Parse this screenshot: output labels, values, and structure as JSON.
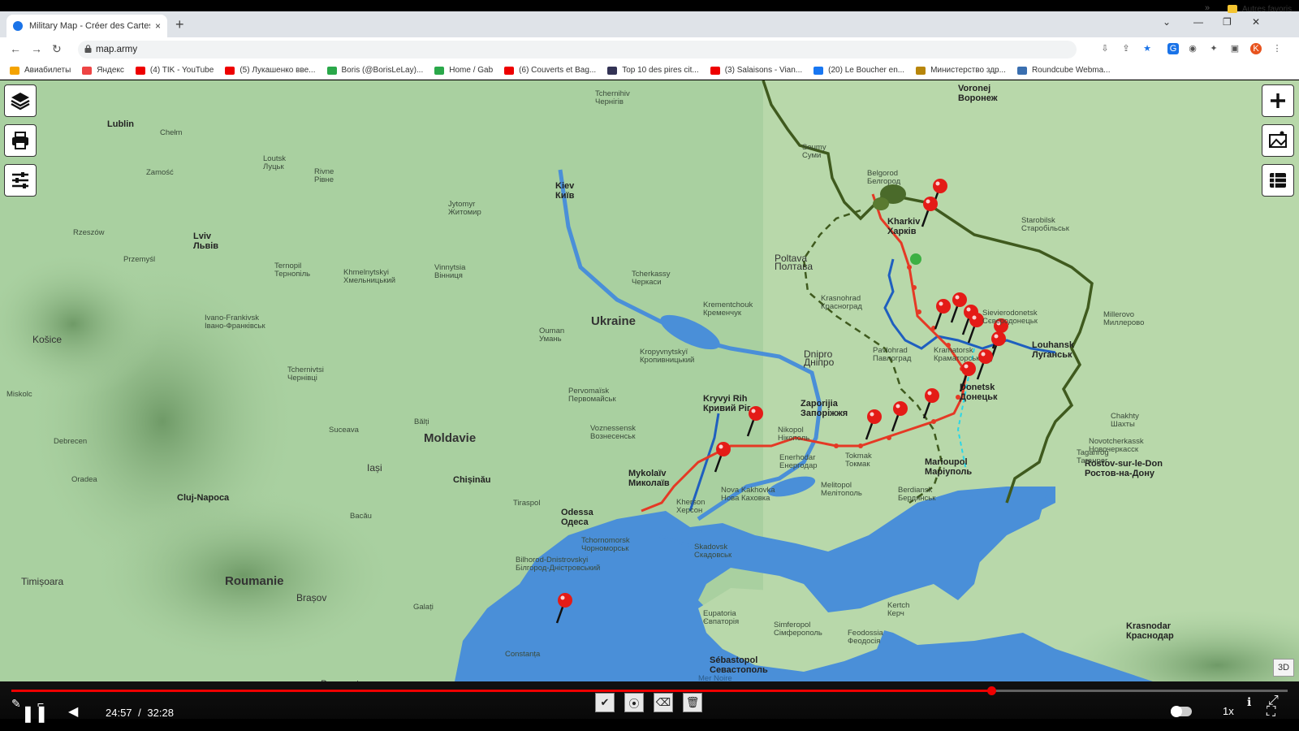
{
  "browser": {
    "tab_title": "Military Map - Créer des Cartes M",
    "tab_close": "×",
    "new_tab": "+",
    "url": "map.army",
    "bookmarks": [
      {
        "label": "Авиабилеты",
        "color": "#f4a300"
      },
      {
        "label": "Яндекс",
        "color": "#e44"
      },
      {
        "label": "(4) TIK - YouTube",
        "color": "#e00"
      },
      {
        "label": "(5) Лукашенко вве...",
        "color": "#e00"
      },
      {
        "label": "Boris (@BorisLeLay)...",
        "color": "#2aa84a"
      },
      {
        "label": "Home / Gab",
        "color": "#2aa84a"
      },
      {
        "label": "(6) Couverts et Bag...",
        "color": "#e00"
      },
      {
        "label": "Top 10 des pires cit...",
        "color": "#335"
      },
      {
        "label": "(3) Salaisons - Vian...",
        "color": "#e00"
      },
      {
        "label": "(20) Le Boucher en...",
        "color": "#1877f2"
      },
      {
        "label": "Министерство здр...",
        "color": "#b8860b"
      },
      {
        "label": "Roundcube Webma...",
        "color": "#3a6fb0"
      }
    ],
    "bookmarks_more": "»",
    "other_bookmarks": "Autres favoris",
    "profile_initial": "K"
  },
  "map": {
    "labels": [
      {
        "t": "Ukraine",
        "c": "big"
      },
      {
        "t": "Moldavie",
        "c": "big"
      },
      {
        "t": "Roumanie",
        "c": "big"
      },
      {
        "t": "Kiev|Київ",
        "c": "city"
      },
      {
        "t": "Poltava|Полтава",
        "c": "mid"
      },
      {
        "t": "Dnipro|Дніпро",
        "c": "mid"
      },
      {
        "t": "Zaporijia|Запоріжжя",
        "c": "city"
      },
      {
        "t": "Kryvyi Rih|Кривий Ріг",
        "c": "city"
      },
      {
        "t": "Mykolaïv|Миколаїв",
        "c": "city"
      },
      {
        "t": "Odessa|Одеса",
        "c": "city"
      },
      {
        "t": "Chișinău",
        "c": "city"
      },
      {
        "t": "Lviv|Львів",
        "c": "city"
      },
      {
        "t": "Kharkiv|Харків",
        "c": "city"
      },
      {
        "t": "Marioupol|Маріуполь",
        "c": "city"
      },
      {
        "t": "Rostov-sur-le-Don|Ростов-на-Дону",
        "c": "city"
      },
      {
        "t": "Lublin",
        "c": "city"
      },
      {
        "t": "Cluj-Napoca",
        "c": "city"
      },
      {
        "t": "Sébastopol|Севастополь",
        "c": "city"
      },
      {
        "t": "Krasnodar|Краснодар",
        "c": "city"
      },
      {
        "t": "Voronej|Воронеж",
        "c": "city"
      },
      {
        "t": "Louhansk|Луганськ",
        "c": "city"
      },
      {
        "t": "Donetsk|Донецьк",
        "c": "city"
      },
      {
        "t": "Belgorod|Белгород",
        "c": ""
      },
      {
        "t": "Soumy|Суми",
        "c": ""
      },
      {
        "t": "Tchernihiv|Чернігів",
        "c": ""
      },
      {
        "t": "Jytomyr|Житомир",
        "c": ""
      },
      {
        "t": "Vinnytsia|Вінниця",
        "c": ""
      },
      {
        "t": "Tcherkassy|Черкаси",
        "c": ""
      },
      {
        "t": "Krementchouk|Кременчук",
        "c": ""
      },
      {
        "t": "Kropyvnytskyï|Кропивницький",
        "c": ""
      },
      {
        "t": "Ouman|Умань",
        "c": ""
      },
      {
        "t": "Khmelnytskyi|Хмельницький",
        "c": ""
      },
      {
        "t": "Ternopil|Тернопіль",
        "c": ""
      },
      {
        "t": "Rivne|Рівне",
        "c": ""
      },
      {
        "t": "Loutsk|Луцьк",
        "c": ""
      },
      {
        "t": "Ivano-Frankivsk|Івано-Франківськ",
        "c": ""
      },
      {
        "t": "Tchernivtsi|Чернівці",
        "c": ""
      },
      {
        "t": "Pervomaïsk|Первомайськ",
        "c": ""
      },
      {
        "t": "Voznessensk|Вознесенськ",
        "c": ""
      },
      {
        "t": "Kherson|Херсон",
        "c": ""
      },
      {
        "t": "Nova Kakhovka|Нова Каховка",
        "c": ""
      },
      {
        "t": "Nikopol|Нікополь",
        "c": ""
      },
      {
        "t": "Enerhodar|Енергодар",
        "c": ""
      },
      {
        "t": "Melitopol|Мелітополь",
        "c": ""
      },
      {
        "t": "Berdiansk|Бердянськ",
        "c": ""
      },
      {
        "t": "Tokmak|Токмак",
        "c": ""
      },
      {
        "t": "Pavlohrad|Павлоград",
        "c": ""
      },
      {
        "t": "Krasnohrad|Красноград",
        "c": ""
      },
      {
        "t": "Kramatorsk|Краматорськ",
        "c": ""
      },
      {
        "t": "Sievierodonetsk|Сєвєродонецьк",
        "c": ""
      },
      {
        "t": "Taganrog|Таганрог",
        "c": ""
      },
      {
        "t": "Tchornomorsk|Чорноморськ",
        "c": ""
      },
      {
        "t": "Skadovsk|Скадовськ",
        "c": ""
      },
      {
        "t": "Eupatoria|Євпаторія",
        "c": ""
      },
      {
        "t": "Simferopol|Сімферополь",
        "c": ""
      },
      {
        "t": "Kertch|Керч",
        "c": ""
      },
      {
        "t": "Feodossia|Феодосія",
        "c": ""
      },
      {
        "t": "Iași",
        "c": "mid"
      },
      {
        "t": "Brașov",
        "c": "mid"
      },
      {
        "t": "Bucarest",
        "c": "mid"
      },
      {
        "t": "Košice",
        "c": "mid"
      },
      {
        "t": "Miskolc",
        "c": ""
      },
      {
        "t": "Debrecen",
        "c": ""
      },
      {
        "t": "Oradea",
        "c": ""
      },
      {
        "t": "Timișoara",
        "c": "mid"
      },
      {
        "t": "Bacău",
        "c": ""
      },
      {
        "t": "Galați",
        "c": ""
      },
      {
        "t": "Constanța",
        "c": ""
      },
      {
        "t": "Suceava",
        "c": ""
      },
      {
        "t": "Bălți",
        "c": ""
      },
      {
        "t": "Tiraspol",
        "c": ""
      },
      {
        "t": "Rzeszów",
        "c": ""
      },
      {
        "t": "Przemyśl",
        "c": ""
      },
      {
        "t": "Zamość",
        "c": ""
      },
      {
        "t": "Chełm",
        "c": ""
      },
      {
        "t": "Mer Noire|Чорне море",
        "c": "sea"
      },
      {
        "t": "Millerovo|Миллерово",
        "c": ""
      },
      {
        "t": "Starobilsk|Старобільськ",
        "c": ""
      },
      {
        "t": "Bilhorod-Dnistrovskyi|Білгород-Дністровський",
        "c": ""
      },
      {
        "t": "Novotcherkassk|Новочеркасск",
        "c": ""
      },
      {
        "t": "Chakhty|Шахты",
        "c": ""
      }
    ]
  },
  "map_controls": {
    "layers": "layers-icon",
    "print": "print-icon",
    "settings": "sliders-icon",
    "zoom_in": "plus-icon",
    "screenshot": "image-frame-icon",
    "list": "list-icon",
    "btn_3d": "3D"
  },
  "video": {
    "current_time": "24:57",
    "separator": "/",
    "duration": "32:28",
    "progress": 0.768,
    "speed": "1x",
    "draw_tools": [
      "check-icon",
      "record-icon",
      "eraser-icon",
      "trash-icon"
    ]
  },
  "colors": {
    "frontline": "#e53925",
    "russian_border": "#3f5a1e",
    "ukraine_defense": "#1f5fbf",
    "pin": "#e41b17",
    "water": "#4a8fd8",
    "land": "#a9d0a0",
    "progress": "#ff0000"
  }
}
